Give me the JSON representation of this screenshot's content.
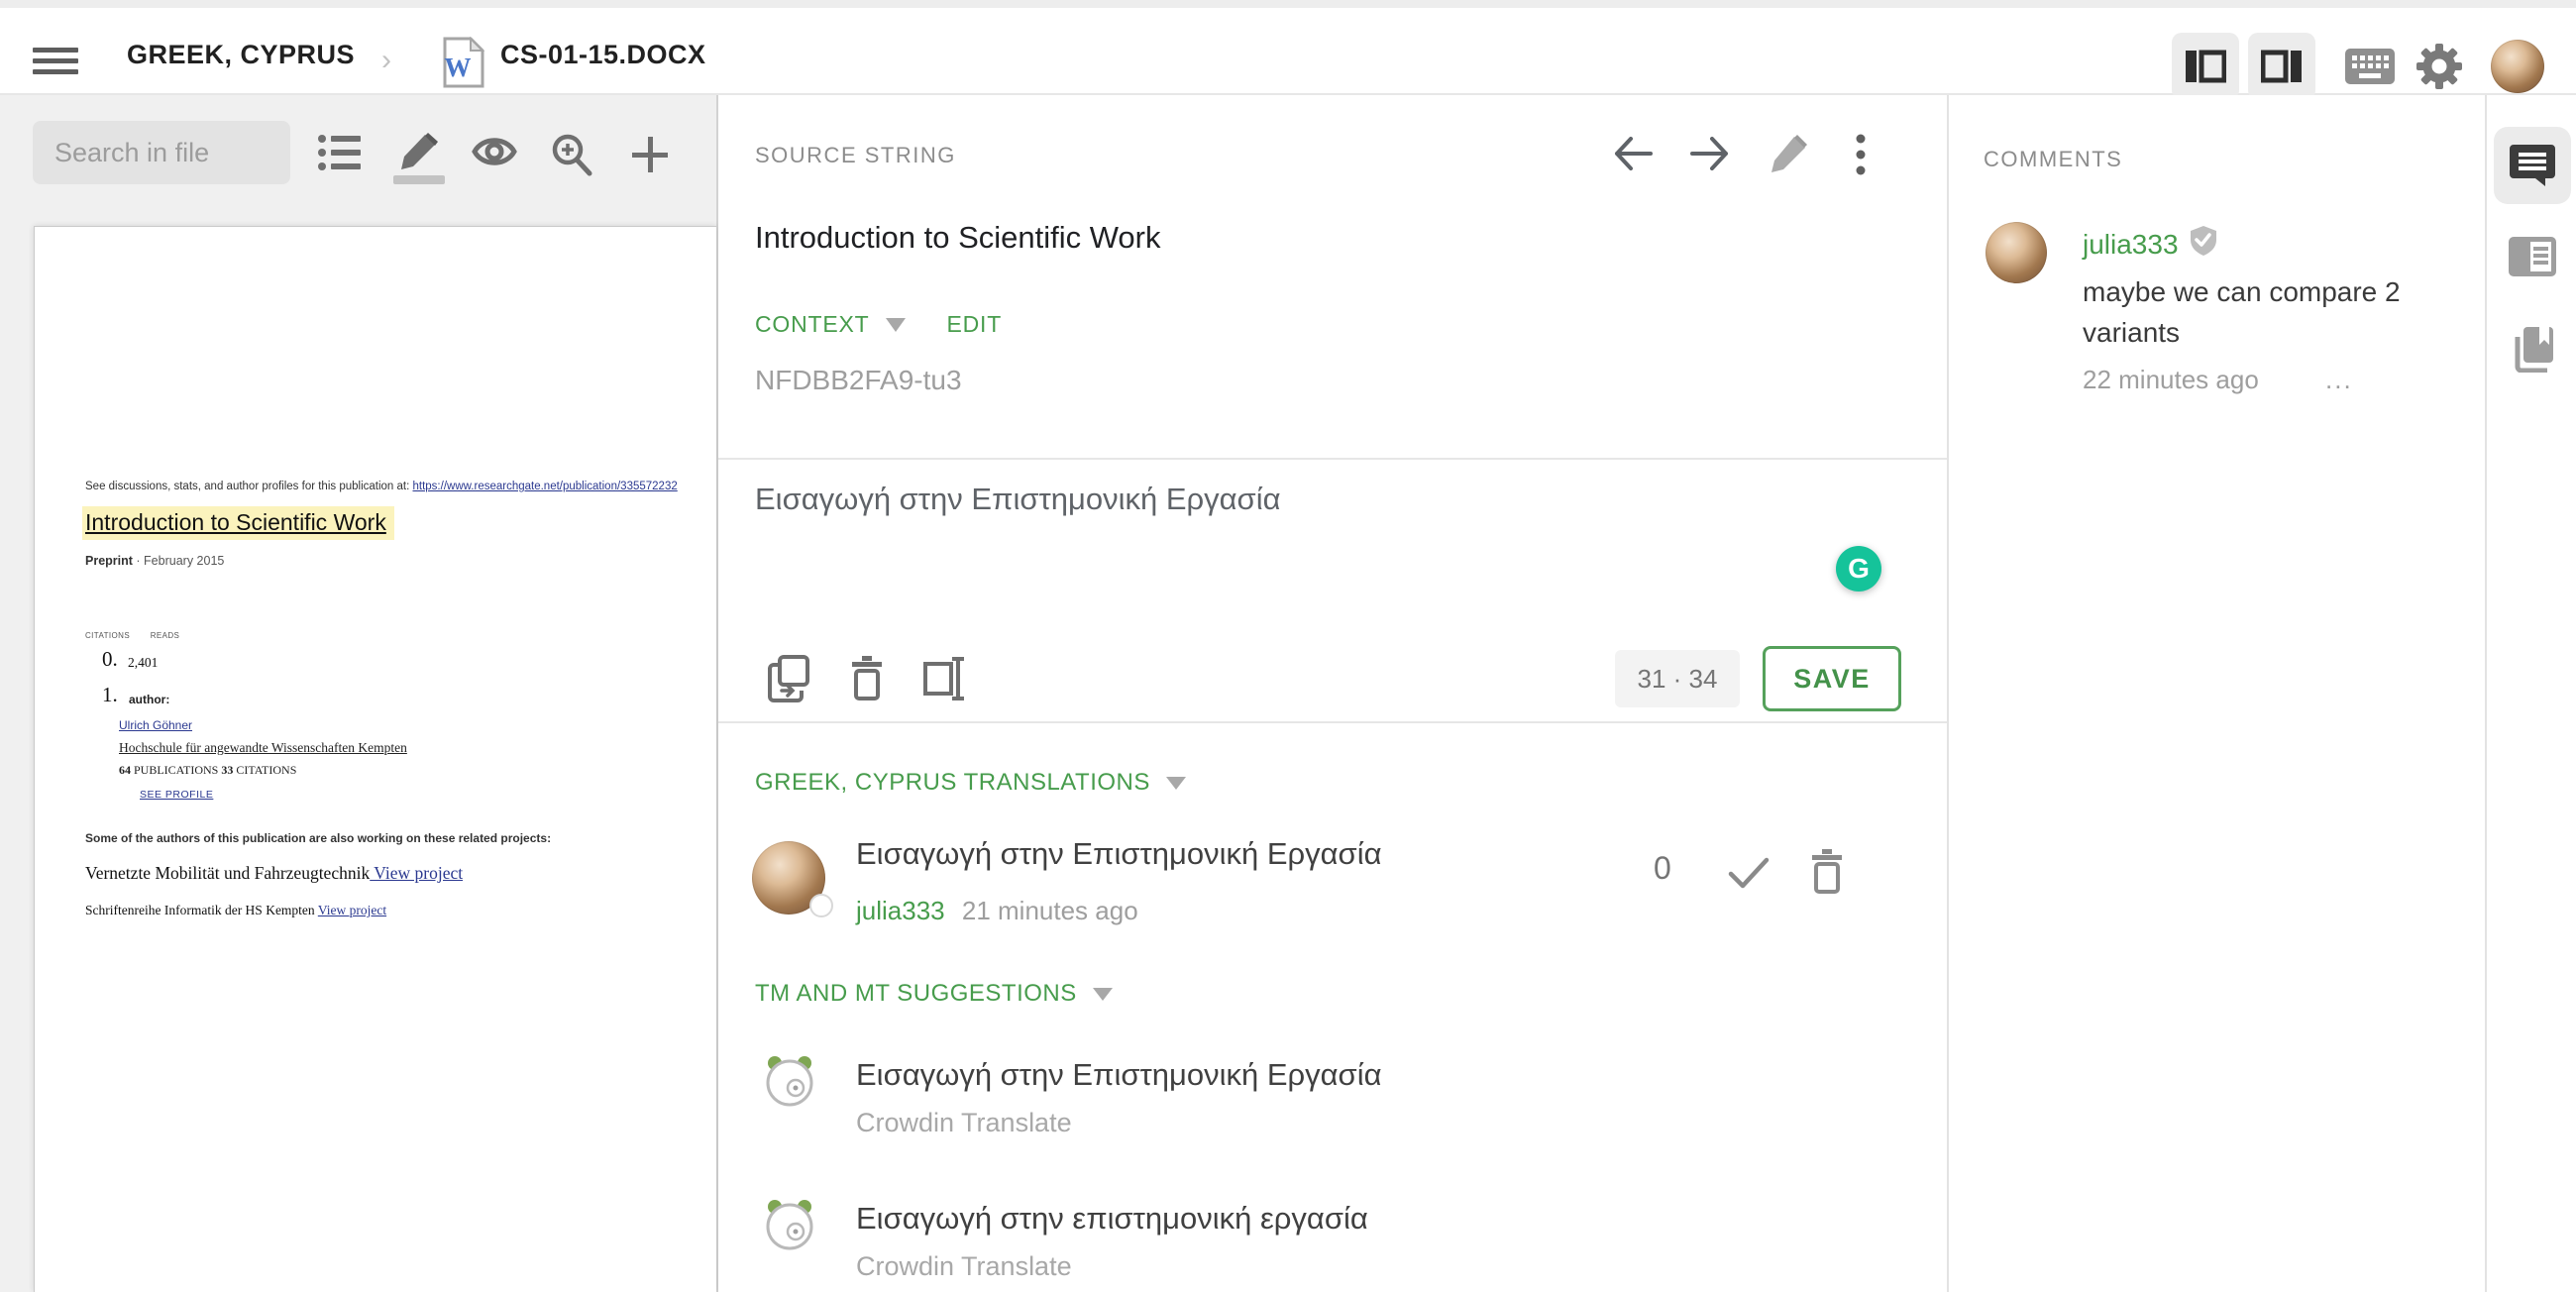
{
  "topbar": {
    "project": "GREEK, CYPRUS",
    "file": "CS-01-15.DOCX"
  },
  "left_panel": {
    "search_placeholder": "Search in file"
  },
  "document": {
    "preface": "See discussions, stats, and author profiles for this publication at: ",
    "preface_link": "https://www.researchgate.net/publication/335572232",
    "title": "Introduction to Scientific Work",
    "preprint_label": "Preprint",
    "preprint_rest": " · February 2015",
    "citations_label": "CITATIONS",
    "reads_label": "READS",
    "citations_value": "0.",
    "reads_value": "2,401",
    "author_index": "1.",
    "author_label": "author:",
    "author_name": "Ulrich Göhner",
    "author_affiliation": "Hochschule für angewandte Wissenschaften Kempten",
    "publications_count": "64",
    "publications_label": " PUBLICATIONS ",
    "citations_count": "33",
    "citations_label2": " CITATIONS",
    "see_profile": "SEE PROFILE",
    "related_intro": "Some of the authors of this publication are also working on these related projects:",
    "projects": [
      {
        "name": "Vernetzte Mobilität und Fahrzeugtechnik",
        "link": " View project"
      },
      {
        "name": "Schriftenreihe Informatik der HS Kempten ",
        "link": "View project"
      }
    ]
  },
  "source_panel": {
    "header": "SOURCE STRING",
    "text": "Introduction to Scientific Work",
    "context_label": "CONTEXT",
    "edit_label": "EDIT",
    "context_value": "NFDBB2FA9-tu3"
  },
  "editor": {
    "value": "Εισαγωγή στην Επιστημονική Εργασία",
    "counter": "31 · 34",
    "save_label": "SAVE",
    "grammarly_letter": "G"
  },
  "translations": {
    "header": "GREEK, CYPRUS TRANSLATIONS",
    "items": [
      {
        "text": "Εισαγωγή στην Επιστημονική Εργασία",
        "author": "julia333",
        "time": "21 minutes ago",
        "votes": "0"
      }
    ]
  },
  "suggestions": {
    "header": "TM AND MT SUGGESTIONS",
    "items": [
      {
        "text": "Εισαγωγή στην Επιστημονική Εργασία",
        "source": "Crowdin Translate"
      },
      {
        "text": "Εισαγωγή στην επιστημονική εργασία",
        "source": "Crowdin Translate"
      }
    ]
  },
  "comments": {
    "header": "COMMENTS",
    "items": [
      {
        "author": "julia333",
        "text": "maybe we can compare 2 variants",
        "time": "22 minutes ago",
        "more": "..."
      }
    ]
  },
  "colors": {
    "accent_green": "#479c4c",
    "grammarly_green": "#15c39a",
    "doc_link_blue": "#2b3990"
  }
}
